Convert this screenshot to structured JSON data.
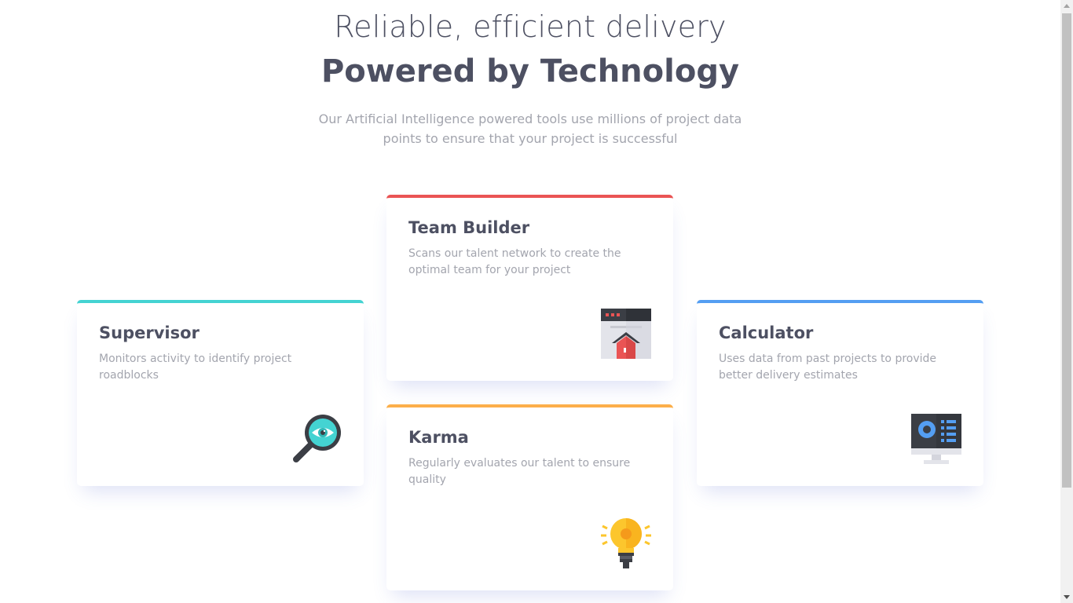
{
  "header": {
    "title_light": "Reliable, efficient delivery",
    "title_bold": "Powered by Technology",
    "intro": "Our Artificial Intelligence powered tools use millions of project data points to ensure that your project is successful"
  },
  "cards": {
    "team_builder": {
      "title": "Team Builder",
      "description": "Scans our talent network to create the optimal team for your project",
      "icon": "team-builder-icon",
      "accent": "#ea5454"
    },
    "supervisor": {
      "title": "Supervisor",
      "description": "Monitors activity to identify project roadblocks",
      "icon": "supervisor-icon",
      "accent": "#44d3d2"
    },
    "calculator": {
      "title": "Calculator",
      "description": "Uses data from past projects to provide better delivery estimates",
      "icon": "calculator-icon",
      "accent": "#549ef2"
    },
    "karma": {
      "title": "Karma",
      "description": "Regularly evaluates our talent to ensure quality",
      "icon": "karma-icon",
      "accent": "#fcaf4a"
    }
  },
  "colors": {
    "text_dark": "#4d5062",
    "text_muted": "#a3a5ae",
    "background": "#ffffff"
  }
}
